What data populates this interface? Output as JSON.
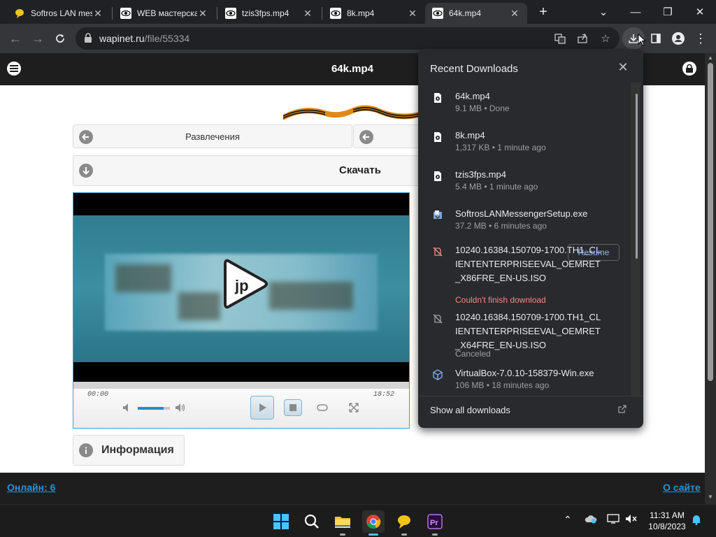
{
  "tabs": [
    {
      "title": "Softros LAN messenger",
      "icon": "softros-icon"
    },
    {
      "title": "WEB мастерская",
      "icon": "eye-icon"
    },
    {
      "title": "tzis3fps.mp4",
      "icon": "eye-icon"
    },
    {
      "title": "8k.mp4",
      "icon": "eye-icon"
    },
    {
      "title": "64k.mp4",
      "icon": "eye-icon"
    }
  ],
  "address": {
    "domain": "wapinet.ru",
    "path": "/file/55334"
  },
  "page": {
    "title": "64k.mp4",
    "nav_left": "Развлечения",
    "download": "Скачать",
    "info": "Информация",
    "time_current": "00:00",
    "time_total": "18:52",
    "volume": 0.8,
    "footer_online": "Онлайн: 6",
    "footer_about": "О сайте"
  },
  "downloads": {
    "title": "Recent Downloads",
    "show_all": "Show all downloads",
    "resume": "Resume",
    "items": [
      {
        "name": "64k.mp4",
        "meta": "9.1 MB • Done",
        "icon": "video-file-icon"
      },
      {
        "name": "8k.mp4",
        "meta": "1,317 KB • 1 minute ago",
        "icon": "video-file-icon"
      },
      {
        "name": "tzis3fps.mp4",
        "meta": "5.4 MB • 1 minute ago",
        "icon": "video-file-icon"
      },
      {
        "name": "SoftrosLANMessengerSetup.exe",
        "meta": "37.2 MB • 6 minutes ago",
        "icon": "installer-icon"
      },
      {
        "name": "10240.16384.150709-1700.TH1_CLIENTENTERPRISEEVAL_OEMRET_X86FRE_EN-US.ISO",
        "meta": "Couldn't finish download",
        "icon": "failed-file-icon"
      },
      {
        "name": "10240.16384.150709-1700.TH1_CLIENTENTERPRISEEVAL_OEMRET_X64FRE_EN-US.ISO",
        "meta": "Canceled",
        "icon": "failed-file-icon"
      },
      {
        "name": "VirtualBox-7.0.10-158379-Win.exe",
        "meta": "106 MB • 18 minutes ago",
        "icon": "virtualbox-icon"
      }
    ]
  },
  "taskbar": {
    "time": "11:31 AM",
    "date": "10/8/2023"
  }
}
